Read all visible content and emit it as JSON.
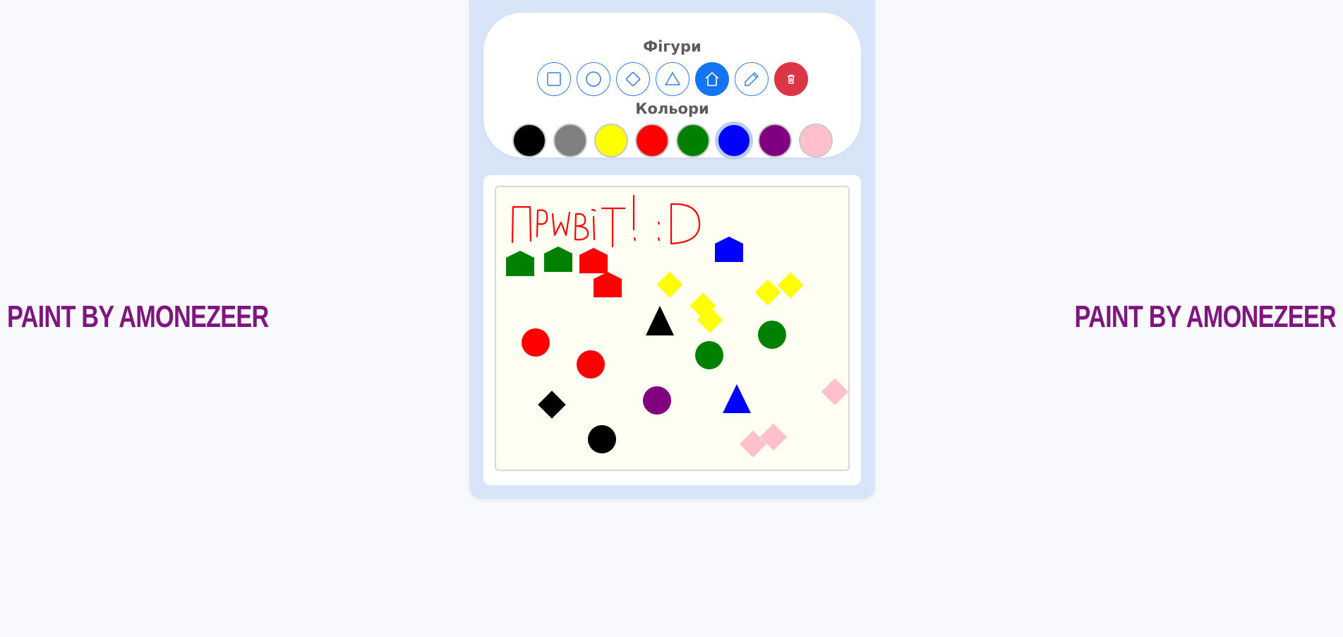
{
  "banner": {
    "left_text": "PAINT BY AMONEZEER",
    "right_text": "PAINT BY AMONEZEER"
  },
  "toolbar": {
    "shapes_label": "Фігури",
    "colors_label": "Кольори",
    "tools": [
      {
        "name": "square-tool",
        "icon": "square-icon",
        "active": false
      },
      {
        "name": "circle-tool",
        "icon": "circle-icon",
        "active": false
      },
      {
        "name": "diamond-tool",
        "icon": "diamond-icon",
        "active": false
      },
      {
        "name": "triangle-tool",
        "icon": "triangle-icon",
        "active": false
      },
      {
        "name": "house-tool",
        "icon": "house-icon",
        "active": true
      },
      {
        "name": "pencil-tool",
        "icon": "pencil-icon",
        "active": false
      },
      {
        "name": "clear-button",
        "icon": "trash-icon",
        "active": false
      }
    ],
    "colors": [
      {
        "name": "black",
        "hex": "#000000"
      },
      {
        "name": "gray",
        "hex": "#808080"
      },
      {
        "name": "yellow",
        "hex": "#ffff00"
      },
      {
        "name": "red",
        "hex": "#ff0000"
      },
      {
        "name": "green",
        "hex": "#008000"
      },
      {
        "name": "blue",
        "hex": "#0000ff",
        "selected": true
      },
      {
        "name": "purple",
        "hex": "#800080"
      },
      {
        "name": "pink",
        "hex": "#ffc0cb"
      }
    ]
  },
  "canvas": {
    "handwritten_text": "ПРИВІТ! :D",
    "drawing_color": "#ff0000",
    "background": "#fefef2"
  }
}
